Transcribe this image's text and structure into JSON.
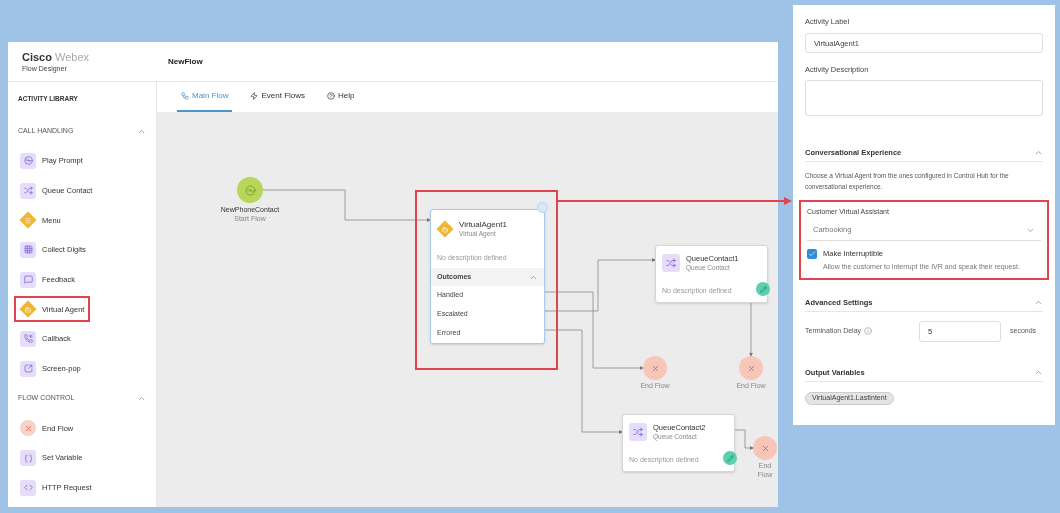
{
  "app": {
    "brand": "Cisco",
    "product": "Webex",
    "subtitle": "Flow Designer",
    "flow_name": "NewFlow"
  },
  "sidebar": {
    "title": "ACTIVITY LIBRARY",
    "groups": [
      {
        "title": "CALL HANDLING",
        "expanded": true,
        "items": [
          {
            "label": "Play Prompt",
            "kind": "action",
            "highlighted": false
          },
          {
            "label": "Queue Contact",
            "kind": "action",
            "highlighted": false
          },
          {
            "label": "Menu",
            "kind": "decision",
            "highlighted": false
          },
          {
            "label": "Collect Digits",
            "kind": "action",
            "highlighted": false
          },
          {
            "label": "Feedback",
            "kind": "action",
            "highlighted": false
          },
          {
            "label": "Virtual Agent",
            "kind": "decision",
            "highlighted": true
          },
          {
            "label": "Callback",
            "kind": "action",
            "highlighted": false
          },
          {
            "label": "Screen-pop",
            "kind": "action",
            "highlighted": false
          }
        ]
      },
      {
        "title": "FLOW CONTROL",
        "expanded": true,
        "items": [
          {
            "label": "End Flow",
            "kind": "end",
            "highlighted": false
          },
          {
            "label": "Set Variable",
            "kind": "action",
            "highlighted": false
          },
          {
            "label": "HTTP Request",
            "kind": "action",
            "highlighted": false
          }
        ]
      }
    ]
  },
  "tabs": [
    {
      "label": "Main Flow",
      "selected": true
    },
    {
      "label": "Event Flows",
      "selected": false
    },
    {
      "label": "Help",
      "selected": false
    }
  ],
  "canvas": {
    "start": {
      "name": "NewPhoneContact",
      "type": "Start Flow"
    },
    "virtual_agent": {
      "title": "VirtualAgent1",
      "type": "Virtual Agent",
      "description": "No description defined",
      "highlighted": true,
      "outcomes_label": "Outcomes",
      "outcomes_expanded": true,
      "outcomes": [
        "Handled",
        "Escalated",
        "Errored"
      ]
    },
    "queue_nodes": [
      {
        "title": "QueueContact1",
        "type": "Queue Contact",
        "description": "No description defined"
      },
      {
        "title": "QueueContact2",
        "type": "Queue Contact",
        "description": "No description defined"
      }
    ],
    "end_nodes": [
      {
        "label": "End Flow"
      },
      {
        "label": "End Flow"
      },
      {
        "label": "End Flow"
      }
    ]
  },
  "panel": {
    "activity_label": {
      "label": "Activity Label",
      "value": "VirtualAgent1"
    },
    "activity_description": {
      "label": "Activity Description"
    },
    "conversational": {
      "title": "Conversational Experience",
      "expanded": true,
      "text": "Choose a Virtual Agent from the ones configured in Control Hub for the conversational experience.",
      "assistant": {
        "highlighted": true,
        "label": "Customer Virtual Assistant",
        "value": "Carbooking",
        "checkbox_label": "Make Interruptible",
        "checked": true,
        "checkbox_hint": "Allow the customer to interrupt the IVR and speak their request."
      }
    },
    "advanced": {
      "title": "Advanced Settings",
      "expanded": true,
      "delay_label": "Termination Delay",
      "delay_value": "5",
      "unit": "seconds"
    },
    "output": {
      "title": "Output Variables",
      "expanded": true,
      "chips": [
        "VirtualAgent1.LastIntent"
      ]
    }
  }
}
